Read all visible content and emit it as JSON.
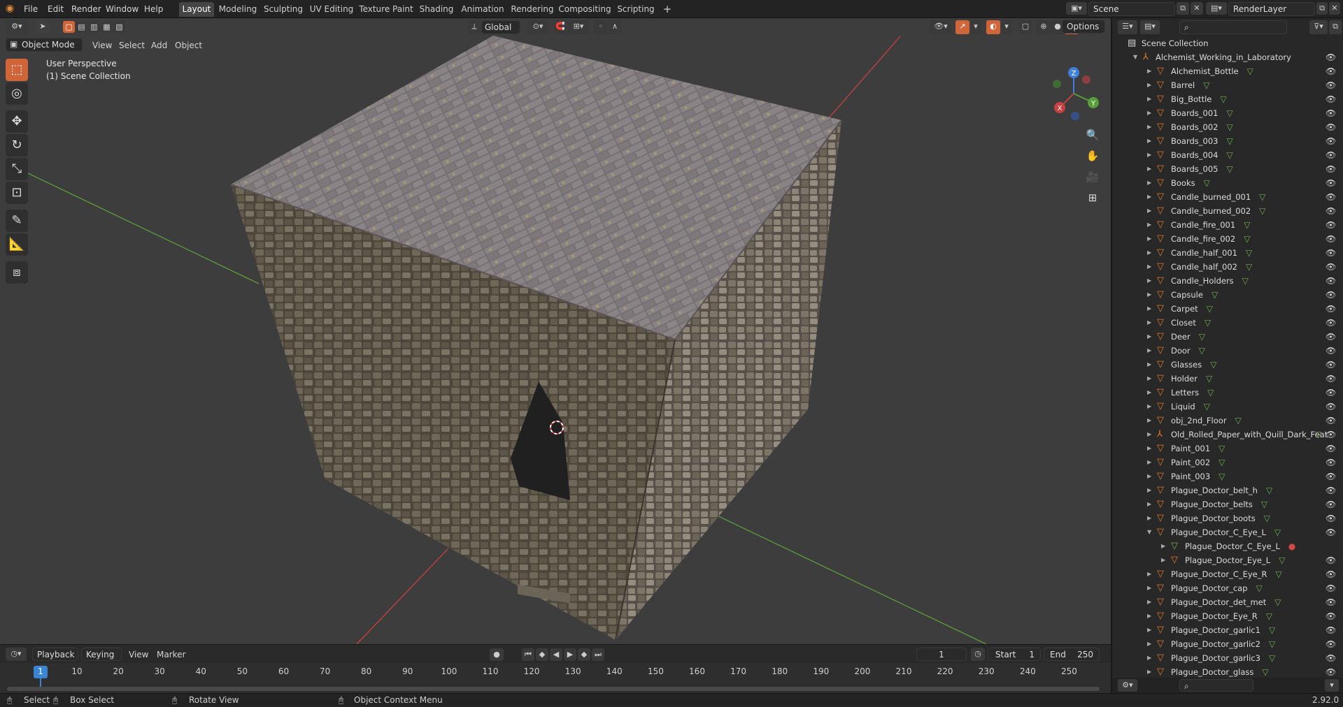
{
  "topbar": {
    "menu": [
      "File",
      "Edit",
      "Render",
      "Window",
      "Help"
    ],
    "workspaces": [
      "Layout",
      "Modeling",
      "Sculpting",
      "UV Editing",
      "Texture Paint",
      "Shading",
      "Animation",
      "Rendering",
      "Compositing",
      "Scripting"
    ],
    "active_workspace": "Layout",
    "add_tab": "+",
    "scene_label": "Scene",
    "renderlayer_label": "RenderLayer"
  },
  "viewport": {
    "mode": "Object Mode",
    "menu": [
      "View",
      "Select",
      "Add",
      "Object"
    ],
    "transform_orientation": "Global",
    "options_label": "Options",
    "overlay_title": "User Perspective",
    "overlay_collection": "(1) Scene Collection",
    "gizmo_axes": {
      "x": "X",
      "y": "Y",
      "z": "Z"
    }
  },
  "outliner": {
    "root": "Scene Collection",
    "collection": "Alchemist_Working_in_Laboratory",
    "items": [
      {
        "name": "Alchemist_Bottle",
        "kind": "obj"
      },
      {
        "name": "Barrel",
        "kind": "obj"
      },
      {
        "name": "Big_Bottle",
        "kind": "obj"
      },
      {
        "name": "Boards_001",
        "kind": "obj"
      },
      {
        "name": "Boards_002",
        "kind": "obj"
      },
      {
        "name": "Boards_003",
        "kind": "obj"
      },
      {
        "name": "Boards_004",
        "kind": "obj"
      },
      {
        "name": "Boards_005",
        "kind": "obj"
      },
      {
        "name": "Books",
        "kind": "obj"
      },
      {
        "name": "Candle_burned_001",
        "kind": "obj"
      },
      {
        "name": "Candle_burned_002",
        "kind": "obj"
      },
      {
        "name": "Candle_fire_001",
        "kind": "obj"
      },
      {
        "name": "Candle_fire_002",
        "kind": "obj"
      },
      {
        "name": "Candle_half_001",
        "kind": "obj"
      },
      {
        "name": "Candle_half_002",
        "kind": "obj"
      },
      {
        "name": "Candle_Holders",
        "kind": "obj"
      },
      {
        "name": "Capsule",
        "kind": "obj"
      },
      {
        "name": "Carpet",
        "kind": "obj"
      },
      {
        "name": "Closet",
        "kind": "obj"
      },
      {
        "name": "Deer",
        "kind": "obj"
      },
      {
        "name": "Door",
        "kind": "obj"
      },
      {
        "name": "Glasses",
        "kind": "obj"
      },
      {
        "name": "Holder",
        "kind": "obj"
      },
      {
        "name": "Letters",
        "kind": "obj"
      },
      {
        "name": "Liquid",
        "kind": "obj"
      },
      {
        "name": "obj_2nd_Floor",
        "kind": "obj"
      },
      {
        "name": "Old_Rolled_Paper_with_Quill_Dark_Feat",
        "kind": "empty"
      },
      {
        "name": "Paint_001",
        "kind": "obj"
      },
      {
        "name": "Paint_002",
        "kind": "obj"
      },
      {
        "name": "Paint_003",
        "kind": "obj"
      },
      {
        "name": "Plague_Doctor_belt_h",
        "kind": "obj"
      },
      {
        "name": "Plague_Doctor_belts",
        "kind": "obj"
      },
      {
        "name": "Plague_Doctor_boots",
        "kind": "obj"
      },
      {
        "name": "Plague_Doctor_C_Eye_L",
        "kind": "obj-open"
      },
      {
        "name": "Plague_Doctor_C_Eye_L",
        "kind": "child-mesh"
      },
      {
        "name": "Plague_Doctor_Eye_L",
        "kind": "child-obj"
      },
      {
        "name": "Plague_Doctor_C_Eye_R",
        "kind": "obj"
      },
      {
        "name": "Plague_Doctor_cap",
        "kind": "obj"
      },
      {
        "name": "Plague_Doctor_det_met",
        "kind": "obj"
      },
      {
        "name": "Plague_Doctor_Eye_R",
        "kind": "obj"
      },
      {
        "name": "Plague_Doctor_garlic1",
        "kind": "obj"
      },
      {
        "name": "Plague_Doctor_garlic2",
        "kind": "obj"
      },
      {
        "name": "Plague_Doctor_garlic3",
        "kind": "obj"
      },
      {
        "name": "Plague_Doctor_glass",
        "kind": "obj"
      }
    ]
  },
  "timeline": {
    "menu": [
      "Playback",
      "Keying",
      "View",
      "Marker"
    ],
    "current_frame": "1",
    "start_label": "Start",
    "start_value": "1",
    "end_label": "End",
    "end_value": "250",
    "ticks": [
      "1",
      "10",
      "20",
      "30",
      "40",
      "50",
      "60",
      "70",
      "80",
      "90",
      "100",
      "110",
      "120",
      "130",
      "140",
      "150",
      "160",
      "170",
      "180",
      "190",
      "200",
      "210",
      "220",
      "230",
      "240",
      "250"
    ]
  },
  "statusbar": {
    "select": "Select",
    "box_select": "Box Select",
    "rotate_view": "Rotate View",
    "context_menu": "Object Context Menu",
    "version": "2.92.0"
  },
  "colors": {
    "accent": "#d0653a",
    "header": "#232323",
    "viewport_bg": "#3d3d3d",
    "outliner_bg": "#282828",
    "object_orange": "#e7792b",
    "mesh_green": "#6fb04e",
    "axis_red": "#c8413f",
    "axis_green": "#5a9e3b",
    "axis_blue": "#3d7fdb"
  }
}
